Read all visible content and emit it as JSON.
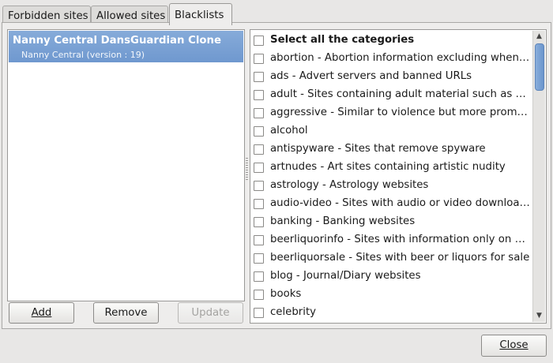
{
  "tabs": [
    "Forbidden sites",
    "Allowed sites",
    "Blacklists"
  ],
  "blacklists": {
    "items": [
      {
        "title": "Nanny Central DansGuardian Clone",
        "subtitle": "Nanny Central (version : 19)"
      }
    ],
    "buttons": {
      "add": "Add",
      "remove": "Remove",
      "update": "Update"
    }
  },
  "categories": {
    "select_all": "Select all the categories",
    "items": [
      "abortion - Abortion information excluding when related to religion",
      "ads - Advert servers and banned URLs",
      "adult - Sites containing adult material such as swearing but not porn",
      "aggressive - Similar to violence but more promoting than depicting",
      "alcohol",
      "antispyware - Sites that remove spyware",
      "artnudes - Art sites containing artistic nudity",
      "astrology - Astrology websites",
      "audio-video - Sites with audio or video downloads",
      "banking - Banking websites",
      "beerliquorinfo - Sites with information only on beer or liquors",
      "beerliquorsale - Sites with beer or liquors for sale",
      "blog - Journal/Diary websites",
      "books",
      "celebrity"
    ]
  },
  "footer": {
    "close": "Close"
  },
  "colors": {
    "selection": "#7aa1d6",
    "window_bg": "#e8e7e6"
  }
}
